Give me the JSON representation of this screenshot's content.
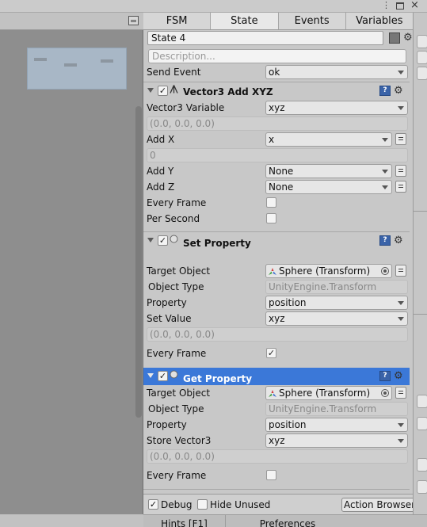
{
  "graph": {
    "menu_icon": "context-menu-icon",
    "minimap_icon": "minimap-viewport"
  },
  "window": {
    "menu_icon": "kebab-menu-icon",
    "maximize_icon": "maximize-icon",
    "close_icon": "close-icon"
  },
  "tabs": [
    "FSM",
    "State",
    "Events",
    "Variables"
  ],
  "active_tab": "State",
  "state": {
    "name": "State 4",
    "color": "#777777",
    "description_placeholder": "Description...",
    "settings_icon": "gear-icon"
  },
  "actions_prev": {
    "send_event_label": "Send Event",
    "send_event_value": "ok"
  },
  "vector3_add_xyz": {
    "title": "Vector3 Add XYZ",
    "icon": "vector3-action-icon",
    "enabled": true,
    "vector3_variable_label": "Vector3 Variable",
    "vector3_variable_value": "xyz",
    "vector3_preview": "(0.0, 0.0, 0.0)",
    "add_x_label": "Add X",
    "add_x_value": "x",
    "add_x_preview": "0",
    "add_y_label": "Add Y",
    "add_y_value": "None",
    "add_z_label": "Add Z",
    "add_z_value": "None",
    "every_frame_label": "Every Frame",
    "every_frame": false,
    "per_second_label": "Per Second",
    "per_second": false
  },
  "set_property": {
    "title": "Set Property",
    "icon": "property-action-icon",
    "enabled": true,
    "target_object_label": "Target Object",
    "target_object_value": "Sphere (Transform)",
    "object_type_label": "Object Type",
    "object_type_value": "UnityEngine.Transform",
    "property_label": "Property",
    "property_value": "position",
    "set_value_label": "Set Value",
    "set_value_value": "xyz",
    "set_value_preview": "(0.0, 0.0, 0.0)",
    "every_frame_label": "Every Frame",
    "every_frame": true
  },
  "get_property": {
    "title": "Get Property",
    "icon": "property-action-icon",
    "enabled": true,
    "selected": true,
    "target_object_label": "Target Object",
    "target_object_value": "Sphere (Transform)",
    "object_type_label": "Object Type",
    "object_type_value": "UnityEngine.Transform",
    "property_label": "Property",
    "property_value": "position",
    "store_label": "Store Vector3",
    "store_value": "xyz",
    "store_preview": "(0.0, 0.0, 0.0)",
    "every_frame_label": "Every Frame",
    "every_frame": false
  },
  "footer": {
    "debug_label": "Debug",
    "debug": true,
    "hide_unused_label": "Hide Unused",
    "hide_unused": false,
    "action_browser_label": "Action Browser"
  },
  "bottombar": {
    "hints_label": "Hints [F1]",
    "preferences_label": "Preferences"
  },
  "colors": {
    "selected_header": "#3b78d8",
    "help_icon": "#3a63a8"
  }
}
